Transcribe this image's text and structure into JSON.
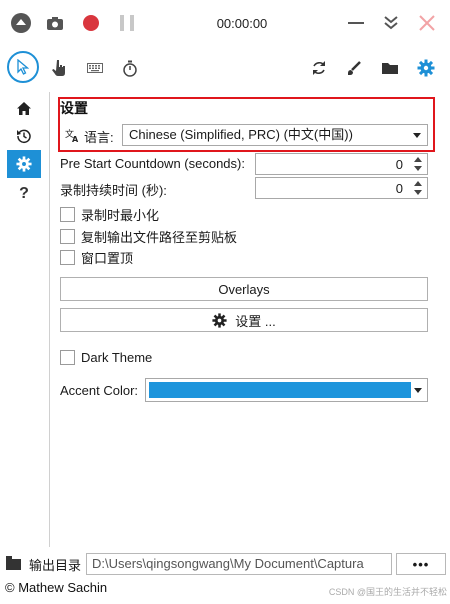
{
  "titlebar": {
    "timer": "00:00:00"
  },
  "settings": {
    "section_title": "设置",
    "language_label": "语言:",
    "language_value": "Chinese (Simplified, PRC) (中文(中国))",
    "countdown_label": "Pre Start Countdown (seconds):",
    "countdown_value": "0",
    "duration_label": "录制持续时间 (秒):",
    "duration_value": "0",
    "minimize_label": "录制时最小化",
    "copy_path_label": "复制输出文件路径至剪贴板",
    "topmost_label": "窗口置顶",
    "overlays_button": "Overlays",
    "more_settings_button": "设置 ...",
    "dark_theme_label": "Dark Theme",
    "accent_label": "Accent Color:",
    "accent_color": "#1e95dc"
  },
  "output": {
    "label": "输出目录",
    "path": "D:\\Users\\qingsongwang\\My Document\\Captura",
    "more_button": "•••"
  },
  "status": {
    "copyright": "© Mathew Sachin",
    "watermark": "CSDN @国王的生活并不轻松"
  },
  "colors": {
    "accent": "#1e90d6",
    "record": "#d9363e",
    "highlight_border": "#e0161c"
  }
}
